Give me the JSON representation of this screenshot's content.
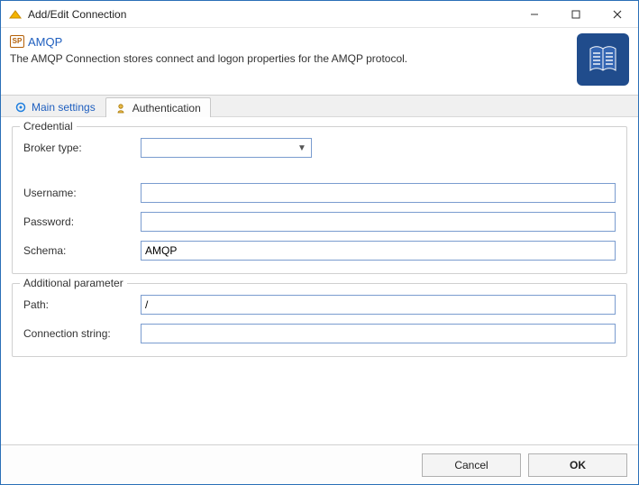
{
  "window": {
    "title": "Add/Edit Connection"
  },
  "header": {
    "connection_name": "AMQP",
    "description": "The AMQP Connection stores connect and logon properties for the AMQP protocol."
  },
  "tabs": {
    "main_settings": "Main settings",
    "authentication": "Authentication"
  },
  "credential": {
    "legend": "Credential",
    "broker_type_label": "Broker type:",
    "broker_type_value": "",
    "username_label": "Username:",
    "username_value": "",
    "password_label": "Password:",
    "password_value": "",
    "schema_label": "Schema:",
    "schema_value": "AMQP"
  },
  "additional": {
    "legend": "Additional parameter",
    "path_label": "Path:",
    "path_value": "/",
    "connstr_label": "Connection string:",
    "connstr_value": ""
  },
  "footer": {
    "cancel": "Cancel",
    "ok": "OK"
  }
}
